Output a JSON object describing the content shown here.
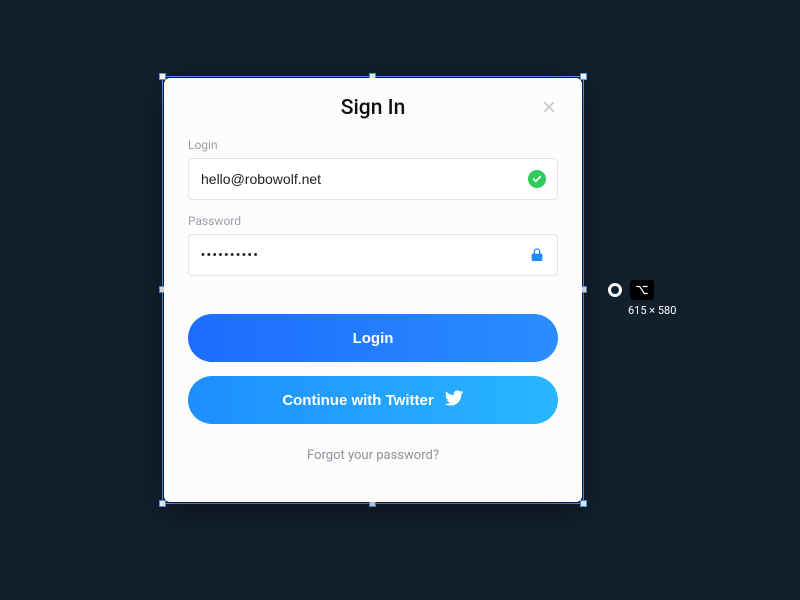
{
  "card": {
    "title": "Sign In",
    "login_label": "Login",
    "login_value": "hello@robowolf.net",
    "password_label": "Password",
    "password_value": "••••••••••",
    "login_button": "Login",
    "twitter_button": "Continue with Twitter",
    "forgot_link": "Forgot your password?"
  },
  "props": {
    "dimensions": "615 × 580"
  }
}
